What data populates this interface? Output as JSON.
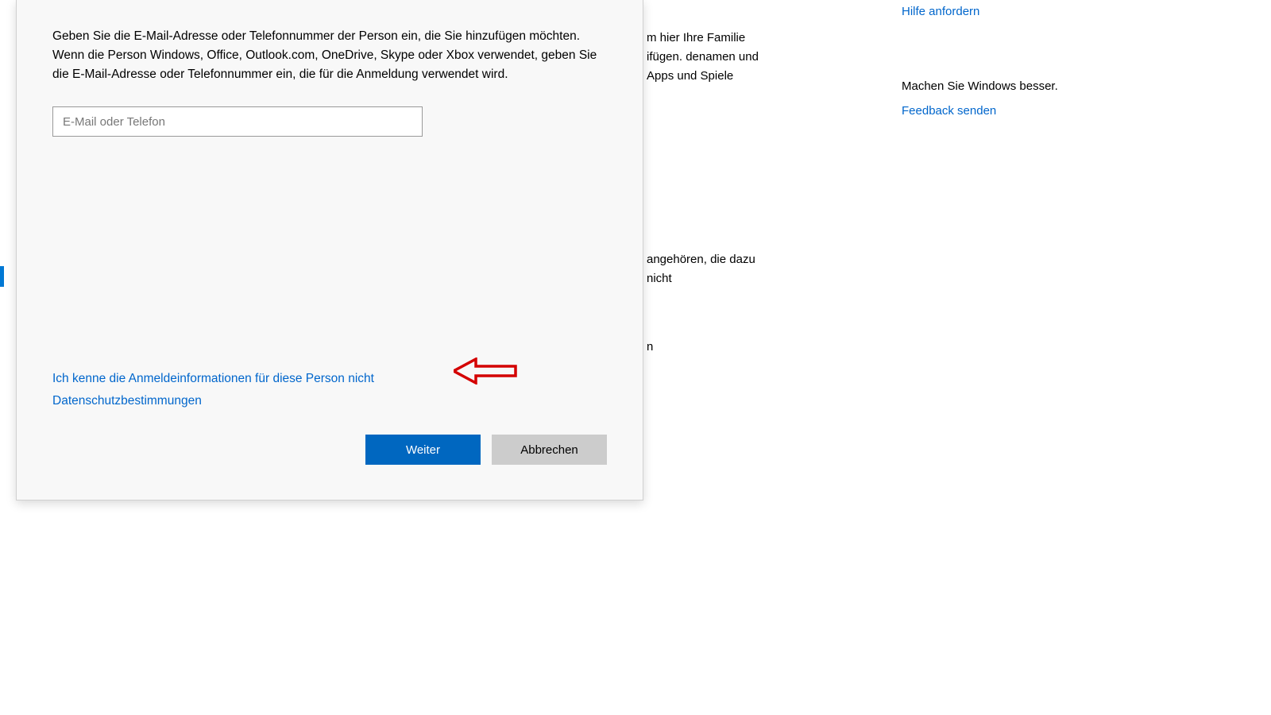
{
  "dialog": {
    "instruction": "Geben Sie die E-Mail-Adresse oder Telefonnummer der Person ein, die Sie hinzufügen möchten. Wenn die Person Windows, Office, Outlook.com, OneDrive, Skype oder Xbox verwendet, geben Sie die E-Mail-Adresse oder Telefonnummer ein, die für die Anmeldung verwendet wird.",
    "input_placeholder": "E-Mail oder Telefon",
    "link_no_credentials": "Ich kenne die Anmeldeinformationen für diese Person nicht",
    "link_privacy": "Datenschutzbestimmungen",
    "button_next": "Weiter",
    "button_cancel": "Abbrechen"
  },
  "background": {
    "text1": "m hier Ihre Familie ifügen. denamen und Apps und Spiele",
    "text2": "angehören, die dazu nicht",
    "text3": "n"
  },
  "sidebar": {
    "help_link": "Hilfe anfordern",
    "feedback_heading": "Machen Sie Windows besser.",
    "feedback_link": "Feedback senden"
  },
  "annotation": {
    "arrow_color": "#d40000"
  }
}
